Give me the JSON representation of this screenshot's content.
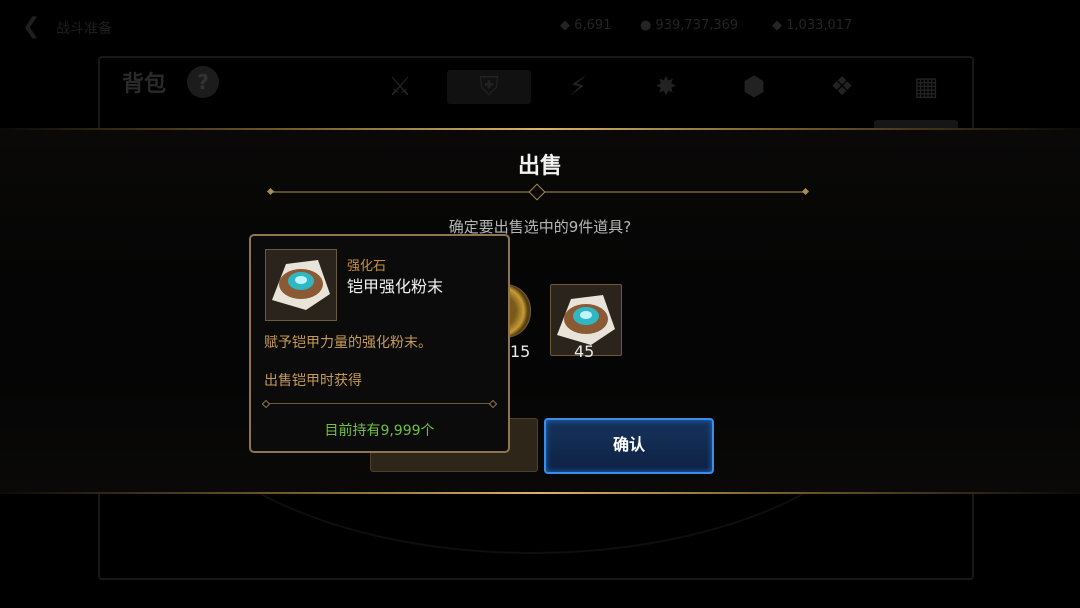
{
  "background": {
    "back_glyph": "❮",
    "window_title": "战斗准备",
    "resources": [
      {
        "icon": "crystal-icon",
        "glyph": "◆",
        "value": "6,691"
      },
      {
        "icon": "gold-icon",
        "glyph": "●",
        "value": "939,737,369"
      },
      {
        "icon": "gem-icon",
        "glyph": "◆",
        "value": "1,033,017"
      }
    ],
    "bag_title": "背包",
    "help_glyph": "?",
    "category_tabs": [
      {
        "name": "weapon-tab",
        "glyph": "⚔"
      },
      {
        "name": "armor-tab",
        "glyph": "⛨"
      },
      {
        "name": "skill-tab",
        "glyph": "⚡"
      },
      {
        "name": "burst-tab",
        "glyph": "✸"
      },
      {
        "name": "material-tab",
        "glyph": "⬢"
      },
      {
        "name": "card-tab",
        "glyph": "❖"
      },
      {
        "name": "misc-tab",
        "glyph": "▦"
      }
    ]
  },
  "dialog": {
    "title": "出售",
    "question": "确定要出售选中的9件道具?",
    "items": [
      {
        "icon": "gold-coin-icon",
        "count": "15"
      },
      {
        "icon": "armor-powder-icon",
        "count": "45"
      }
    ],
    "confirm_label": "确认"
  },
  "tooltip": {
    "category": "强化石",
    "name": "铠甲强化粉末",
    "description": "赋予铠甲力量的强化粉末。",
    "source": "出售铠甲时获得",
    "owned": "目前持有9,999个"
  },
  "colors": {
    "accent_gold": "#d8b46a",
    "confirm_border": "#3b8ee8",
    "owned_text": "#6fc23c",
    "category_text": "#c8923e"
  }
}
